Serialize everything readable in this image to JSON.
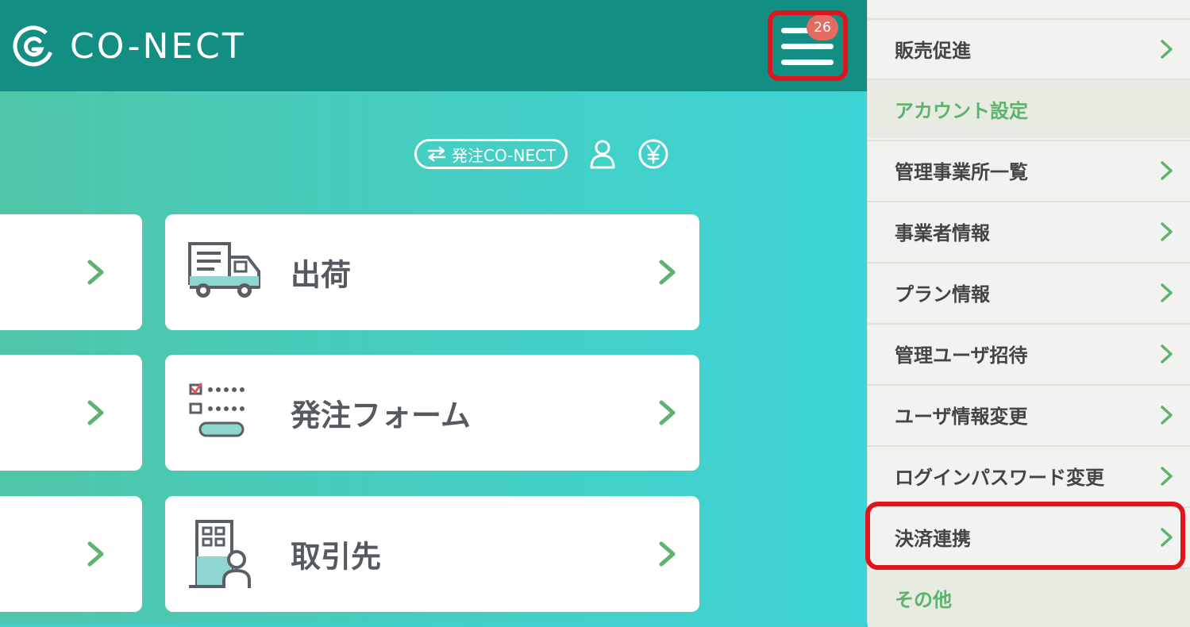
{
  "header": {
    "logo_text": "CO-NECT",
    "logo_icon": "co-nect-logo-icon",
    "menu_icon": "hamburger-menu-icon",
    "notification_count": "26",
    "colors": {
      "header_bg": "#138e82",
      "badge": "#e56c62",
      "highlight": "#e0141c"
    }
  },
  "toolbar": {
    "order_switch_label": "発注CO-NECT",
    "order_switch_icon": "switch-arrows-icon",
    "user_icon": "user-icon",
    "yen_icon": "yen-icon"
  },
  "cards": [
    {
      "label": "出荷",
      "icon": "delivery-truck-icon"
    },
    {
      "label": "発注フォーム",
      "icon": "order-form-checklist-icon"
    },
    {
      "label": "取引先",
      "icon": "business-partner-icon"
    }
  ],
  "drawer": {
    "items": [
      {
        "label": "",
        "type": "link"
      },
      {
        "label": "販売促進",
        "type": "link"
      },
      {
        "label": "アカウント設定",
        "type": "section"
      },
      {
        "label": "管理事業所一覧",
        "type": "link"
      },
      {
        "label": "事業者情報",
        "type": "link"
      },
      {
        "label": "プラン情報",
        "type": "link"
      },
      {
        "label": "管理ユーザ招待",
        "type": "link"
      },
      {
        "label": "ユーザ情報変更",
        "type": "link"
      },
      {
        "label": "ログインパスワード変更",
        "type": "link"
      },
      {
        "label": "決済連携",
        "type": "link",
        "highlighted": true
      },
      {
        "label": "その他",
        "type": "section"
      }
    ],
    "accent_color": "#5bb46c"
  }
}
